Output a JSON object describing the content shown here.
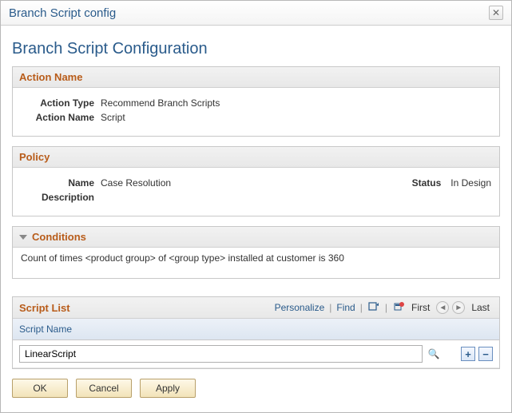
{
  "dialog": {
    "title": "Branch Script config",
    "close_glyph": "✕"
  },
  "page_title": "Branch Script Configuration",
  "action_name_section": {
    "header": "Action Name",
    "type_label": "Action Type",
    "type_value": "Recommend Branch Scripts",
    "name_label": "Action Name",
    "name_value": "Script"
  },
  "policy_section": {
    "header": "Policy",
    "name_label": "Name",
    "name_value": "Case Resolution",
    "status_label": "Status",
    "status_value": "In Design",
    "description_label": "Description",
    "description_value": ""
  },
  "conditions_section": {
    "header": "Conditions",
    "text": "Count of times <product group> of <group type> installed at customer is 360"
  },
  "script_list": {
    "header": "Script List",
    "personalize": "Personalize",
    "find": "Find",
    "first": "First",
    "last": "Last",
    "column_header": "Script Name",
    "row_value": "LinearScript",
    "prev_glyph": "◄",
    "next_glyph": "►",
    "add_glyph": "+",
    "remove_glyph": "−",
    "lookup_glyph": "🔍",
    "sep": "|"
  },
  "buttons": {
    "ok": "OK",
    "cancel": "Cancel",
    "apply": "Apply"
  }
}
